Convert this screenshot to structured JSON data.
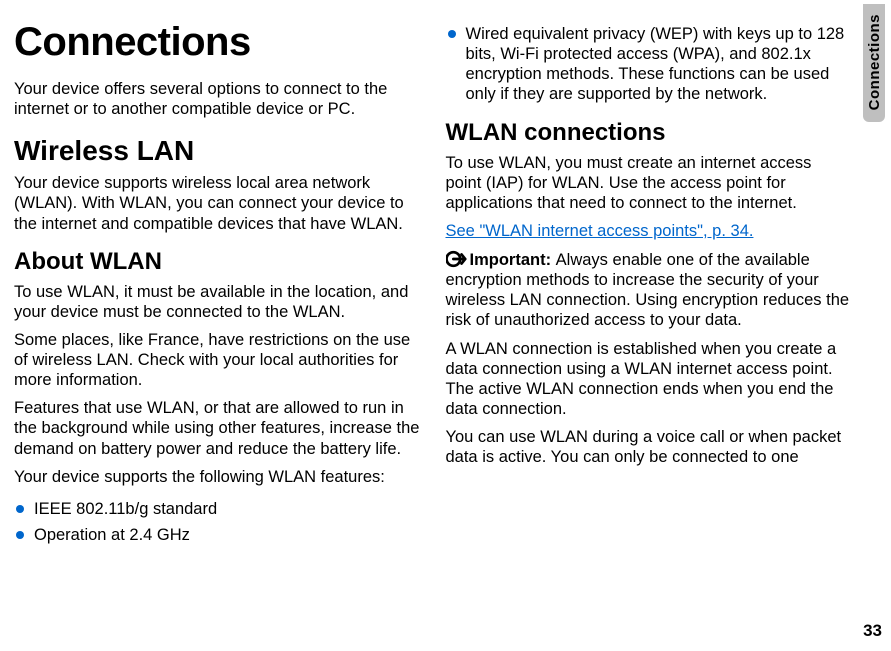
{
  "sidetab": "Connections",
  "page_number": "33",
  "title": "Connections",
  "intro": "Your device offers several options to connect to the internet or to another compatible device or PC.",
  "wireless_lan": {
    "heading": "Wireless LAN",
    "text": "Your device supports wireless local area network (WLAN). With WLAN, you can connect your device to the internet and compatible devices that have WLAN."
  },
  "about_wlan": {
    "heading": "About WLAN",
    "p1": "To use WLAN, it must be available in the location, and your device must be connected to the WLAN.",
    "p2": "Some places, like France, have restrictions on the use of wireless LAN. Check with your local authorities for more information.",
    "p3": "Features that use WLAN, or that are allowed to run in the background while using other features, increase the demand on battery power and reduce the battery life.",
    "p4": "Your device supports the following WLAN features:",
    "features": [
      "IEEE 802.11b/g standard",
      "Operation at 2.4 GHz",
      "Wired equivalent privacy (WEP) with keys up to 128 bits, Wi-Fi protected access (WPA), and 802.1x encryption methods. These functions can be used only if they are supported by the network."
    ]
  },
  "wlan_connections": {
    "heading": "WLAN connections",
    "p1": "To use WLAN, you must create an internet access point (IAP) for WLAN. Use the access point for applications that need to connect to the internet.",
    "link": "See \"WLAN internet access points\", p. 34.",
    "important_label": "Important:  ",
    "important_text": "Always enable one of the available encryption methods to increase the security of your wireless LAN connection. Using encryption reduces the risk of unauthorized access to your data.",
    "p2": "A WLAN connection is established when you create a data connection using a WLAN internet access point. The active WLAN connection ends when you end the data connection.",
    "p3": "You can use WLAN during a voice call or when packet data is active. You can only be connected to one"
  }
}
